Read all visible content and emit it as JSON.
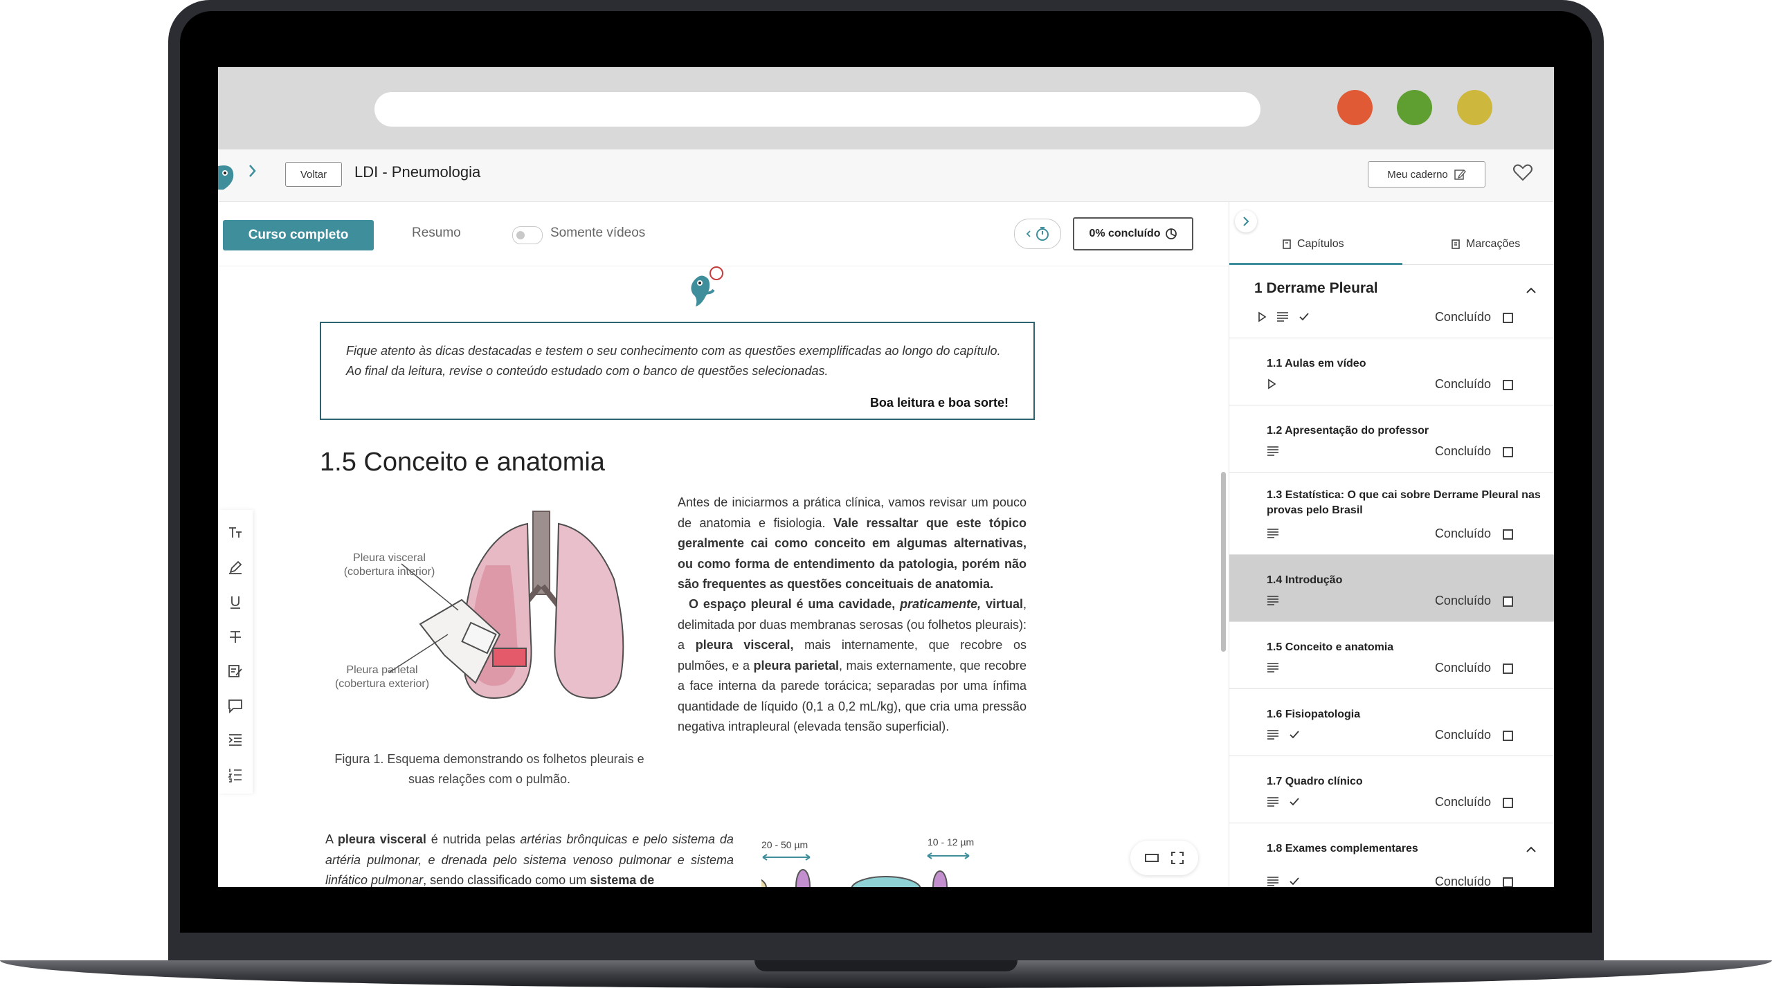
{
  "header": {
    "back_label": "Voltar",
    "title": "LDI - Pneumologia",
    "caderno_label": "Meu caderno"
  },
  "toolbar": {
    "curso_label": "Curso completo",
    "resumo_label": "Resumo",
    "videos_label": "Somente vídeos",
    "progress_label": "0% concluído"
  },
  "colors": {
    "accent": "#3f8e9c",
    "dot_red": "#e05a35",
    "dot_green": "#5f9e31",
    "dot_yellow": "#cdb73c"
  },
  "content": {
    "tip_line1": "Fique atento às dicas destacadas e testem o seu conhecimento com as questões exemplificadas ao longo do capítulo.",
    "tip_line2": "Ao final da leitura, revise o conteúdo estudado com o banco de questões selecionadas.",
    "tip_sign": "Boa leitura e boa sorte!",
    "heading": "1.5 Conceito e anatomia",
    "fig_label_visceral_1": "Pleura visceral",
    "fig_label_visceral_2": "(cobertura interior)",
    "fig_label_parietal_1": "Pleura parietal",
    "fig_label_parietal_2": "(cobertura exterior)",
    "caption_1": "Figura 1. Esquema demonstrando os folhetos pleurais e",
    "caption_2": "suas relações com o pulmão.",
    "p1_normal": "Antes de iniciarmos a prática clínica, vamos revisar um pouco de anatomia e fisiologia.",
    "p1_bold": "Vale ressaltar que este tópico geralmente cai como conceito em algumas alternativas, ou como forma de entendimento da patologia, porém não são frequentes as questões conceituais de anatomia.",
    "p2_a": "O espaço pleural é uma cavidade,",
    "p2_b": "praticamente,",
    "p2_c": "virtual",
    "p2_d": ", delimitada por duas membranas serosas (ou folhetos pleurais): a",
    "p2_e": "pleura visceral,",
    "p2_f": "mais internamente, que recobre os pulmões, e a",
    "p2_g": "pleura parietal",
    "p2_h": ", mais externamente, que recobre a face interna da parede torácica; separadas por uma ínfima quantidade de líquido (0,1 a 0,2 mL/kg), que cria uma pressão negativa intrapleural (elevada tensão superficial).",
    "p3_a": "A",
    "p3_b": "pleura visceral",
    "p3_c": "é nutrida pelas",
    "p3_d": "artérias brônquicas e pelo sistema da artéria pulmonar, e drenada pelo sistema venoso pulmonar e sistema linfático pulmonar",
    "p3_e": ", sendo classificado como um",
    "p3_f": "sistema de",
    "diag_label_1": "20 - 50 µm",
    "diag_label_2": "10 - 12 µm"
  },
  "sidebar": {
    "tab_capitulos": "Capítulos",
    "tab_marcacoes": "Marcações",
    "done_label": "Concluído",
    "items": [
      {
        "title": "1 Derrame Pleural"
      },
      {
        "title": "1.1 Aulas em vídeo"
      },
      {
        "title": "1.2 Apresentação do professor"
      },
      {
        "title": "1.3 Estatística: O que cai sobre Derrame Pleural nas provas pelo Brasil"
      },
      {
        "title": "1.4 Introdução"
      },
      {
        "title": "1.5 Conceito e anatomia"
      },
      {
        "title": "1.6 Fisiopatologia"
      },
      {
        "title": "1.7 Quadro clínico"
      },
      {
        "title": "1.8 Exames complementares"
      }
    ]
  }
}
